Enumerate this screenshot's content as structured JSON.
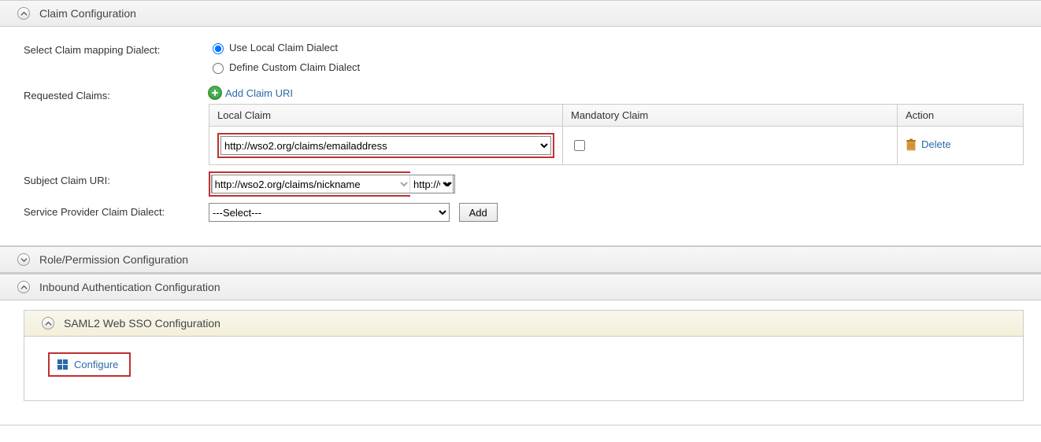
{
  "sections": {
    "claim": {
      "title": "Claim Configuration",
      "expanded": true
    },
    "role": {
      "title": "Role/Permission Configuration",
      "expanded": false
    },
    "inbound": {
      "title": "Inbound Authentication Configuration",
      "expanded": true
    },
    "saml": {
      "title": "SAML2 Web SSO Configuration",
      "expanded": true
    }
  },
  "labels": {
    "selectDialect": "Select Claim mapping Dialect:",
    "requestedClaims": "Requested Claims:",
    "subjectClaimUri": "Subject Claim URI:",
    "spClaimDialect": "Service Provider Claim Dialect:"
  },
  "dialectOptions": {
    "local": "Use Local Claim Dialect",
    "custom": "Define Custom Claim Dialect",
    "selected": "local"
  },
  "addClaimUri": "Add Claim URI",
  "tableHeaders": {
    "local": "Local Claim",
    "mandatory": "Mandatory Claim",
    "action": "Action"
  },
  "claimRow": {
    "localClaim": "http://wso2.org/claims/emailaddress",
    "mandatory": false,
    "deleteLabel": "Delete"
  },
  "subjectClaim": {
    "selected": "http://wso2.org/claims/nickname"
  },
  "spDialect": {
    "selected": "---Select---",
    "addLabel": "Add"
  },
  "configure": {
    "label": "Configure"
  }
}
